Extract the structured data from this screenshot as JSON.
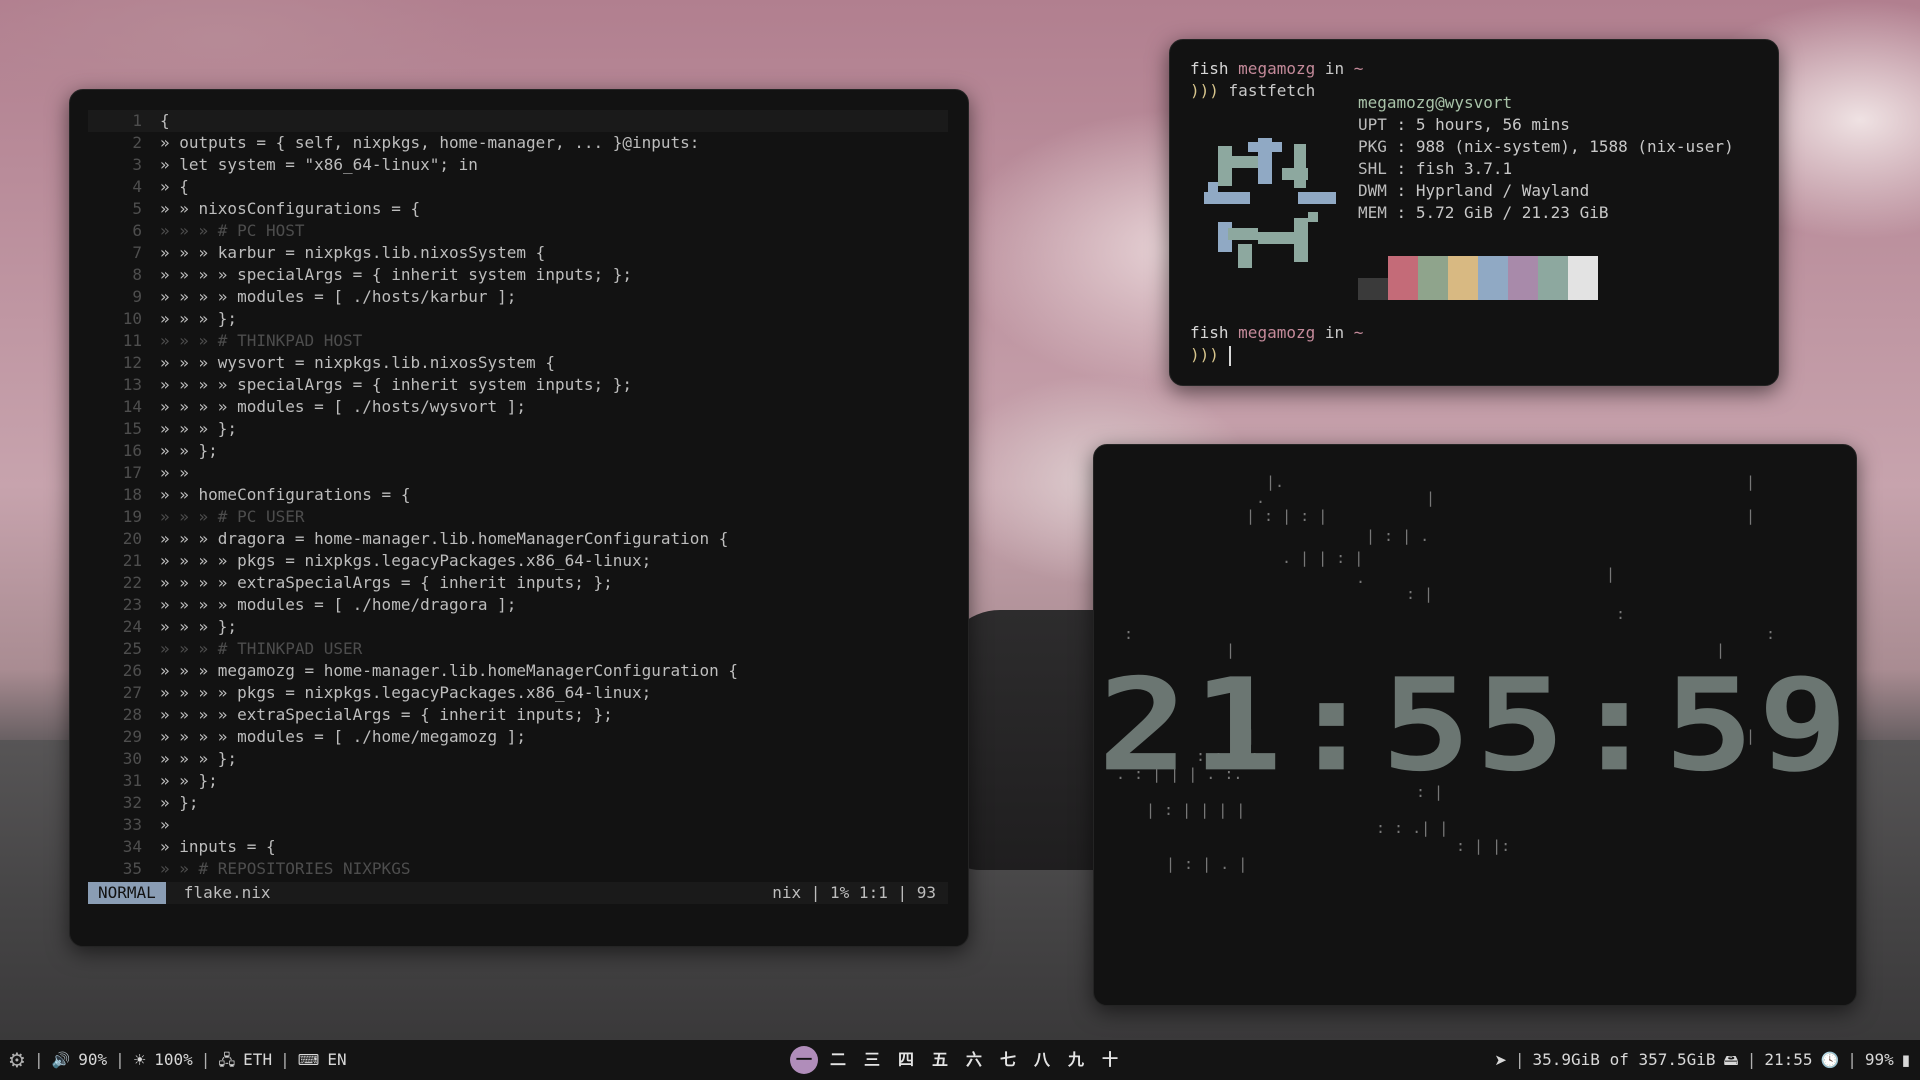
{
  "editor": {
    "lines": [
      {
        "n": "1",
        "t": "{"
      },
      {
        "n": "2",
        "t": "» outputs = { self, nixpkgs, home-manager, ... }@inputs:"
      },
      {
        "n": "3",
        "t": "» let system = \"x86_64-linux\"; in"
      },
      {
        "n": "4",
        "t": "» {"
      },
      {
        "n": "5",
        "t": "» » nixosConfigurations = {"
      },
      {
        "n": "6",
        "t": "» » » # PC HOST"
      },
      {
        "n": "7",
        "t": "» » » karbur = nixpkgs.lib.nixosSystem {"
      },
      {
        "n": "8",
        "t": "» » » » specialArgs = { inherit system inputs; };"
      },
      {
        "n": "9",
        "t": "» » » » modules = [ ./hosts/karbur ];"
      },
      {
        "n": "10",
        "t": "» » » };"
      },
      {
        "n": "11",
        "t": "» » » # THINKPAD HOST"
      },
      {
        "n": "12",
        "t": "» » » wysvort = nixpkgs.lib.nixosSystem {"
      },
      {
        "n": "13",
        "t": "» » » » specialArgs = { inherit system inputs; };"
      },
      {
        "n": "14",
        "t": "» » » » modules = [ ./hosts/wysvort ];"
      },
      {
        "n": "15",
        "t": "» » » };"
      },
      {
        "n": "16",
        "t": "» » };"
      },
      {
        "n": "17",
        "t": "» »"
      },
      {
        "n": "18",
        "t": "» » homeConfigurations = {"
      },
      {
        "n": "19",
        "t": "» » » # PC USER"
      },
      {
        "n": "20",
        "t": "» » » dragora = home-manager.lib.homeManagerConfiguration {"
      },
      {
        "n": "21",
        "t": "» » » » pkgs = nixpkgs.legacyPackages.x86_64-linux;"
      },
      {
        "n": "22",
        "t": "» » » » extraSpecialArgs = { inherit inputs; };"
      },
      {
        "n": "23",
        "t": "» » » » modules = [ ./home/dragora ];"
      },
      {
        "n": "24",
        "t": "» » » };"
      },
      {
        "n": "25",
        "t": "» » » # THINKPAD USER"
      },
      {
        "n": "26",
        "t": "» » » megamozg = home-manager.lib.homeManagerConfiguration {"
      },
      {
        "n": "27",
        "t": "» » » » pkgs = nixpkgs.legacyPackages.x86_64-linux;"
      },
      {
        "n": "28",
        "t": "» » » » extraSpecialArgs = { inherit inputs; };"
      },
      {
        "n": "29",
        "t": "» » » » modules = [ ./home/megamozg ];"
      },
      {
        "n": "30",
        "t": "» » » };"
      },
      {
        "n": "31",
        "t": "» » };"
      },
      {
        "n": "32",
        "t": "» };"
      },
      {
        "n": "33",
        "t": "»"
      },
      {
        "n": "34",
        "t": "» inputs = {"
      },
      {
        "n": "35",
        "t": "» » # REPOSITORIES NIXPKGS"
      }
    ],
    "status": {
      "mode": "NORMAL",
      "filename": "flake.nix",
      "right": "nix | 1% 1:1 | 93"
    }
  },
  "terminal": {
    "prompt1_shell": "fish",
    "prompt1_user": "megamozg",
    "prompt1_in": "in",
    "prompt1_dir": "~",
    "prompt_arrows": ")))",
    "command": "fastfetch",
    "userhost": "megamozg@wysvort",
    "info": [
      {
        "k": "UPT",
        "v": "5 hours, 56 mins"
      },
      {
        "k": "PKG",
        "v": "988 (nix-system), 1588 (nix-user)"
      },
      {
        "k": "SHL",
        "v": "fish 3.7.1"
      },
      {
        "k": "DWM",
        "v": "Hyprland / Wayland"
      },
      {
        "k": "MEM",
        "v": "5.72 GiB / 21.23 GiB"
      }
    ],
    "palette": [
      "#3a3a3a",
      "#c46b78",
      "#8fa48c",
      "#d8b982",
      "#90a9c4",
      "#a88aaa",
      "#8da89f",
      "#e3e3e3"
    ],
    "prompt2_shell": "fish",
    "prompt2_user": "megamozg",
    "prompt2_in": "in",
    "prompt2_dir": "~"
  },
  "clock": {
    "time": "21:55:59"
  },
  "bar": {
    "volume": "90%",
    "brightness": "100%",
    "network": "ETH",
    "layout": "EN",
    "workspaces": [
      "一",
      "二",
      "三",
      "四",
      "五",
      "六",
      "七",
      "八",
      "九",
      "十"
    ],
    "active_workspace": 0,
    "disk": "35.9GiB of 357.5GiB",
    "time": "21:55",
    "battery": "99%"
  }
}
